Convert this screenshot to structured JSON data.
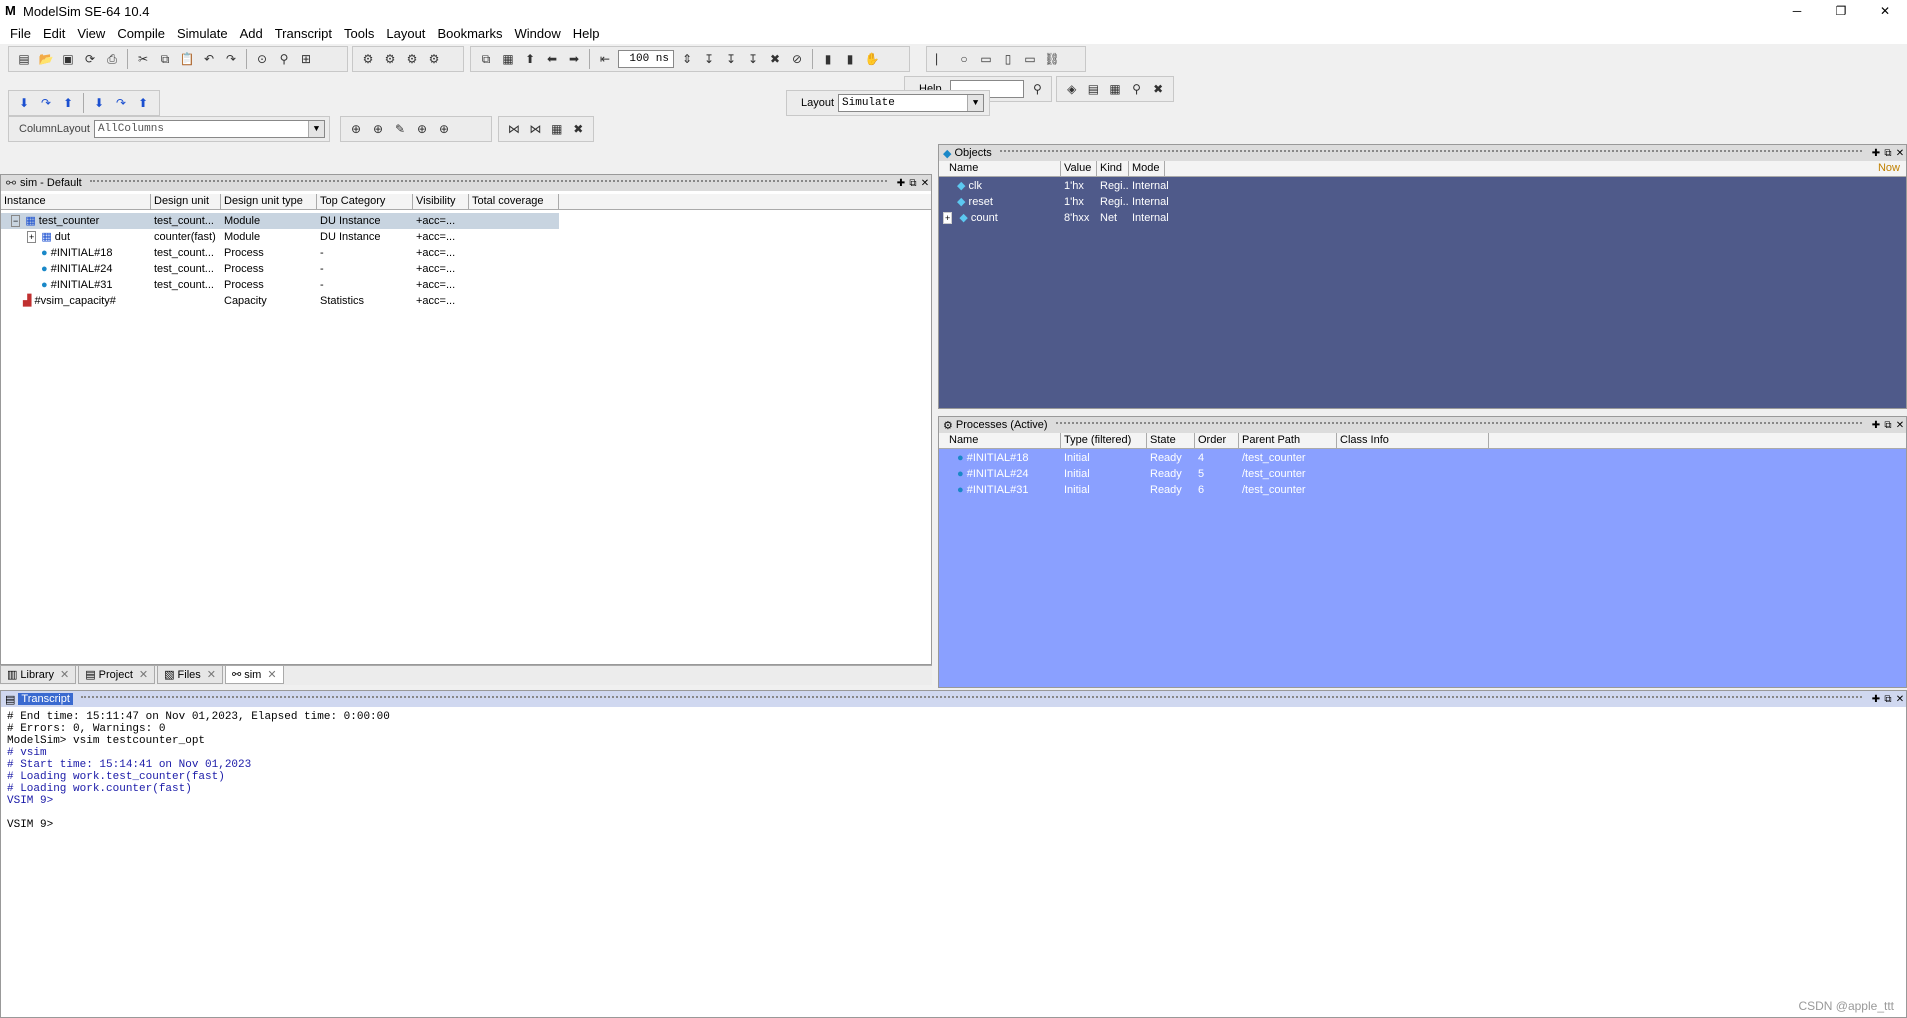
{
  "window": {
    "title": "ModelSim SE-64 10.4",
    "minimize": "─",
    "restore": "❐",
    "close": "✕"
  },
  "menu": [
    "File",
    "Edit",
    "View",
    "Compile",
    "Simulate",
    "Add",
    "Transcript",
    "Tools",
    "Layout",
    "Bookmarks",
    "Window",
    "Help"
  ],
  "toolbar": {
    "run_length": "100 ns",
    "help_label": "Help",
    "help_value": "",
    "layout_label": "Layout",
    "layout_value": "Simulate",
    "column_layout_label": "ColumnLayout",
    "column_layout_value": "AllColumns"
  },
  "sim_pane": {
    "title": "sim - Default",
    "columns": [
      "Instance",
      "Design unit",
      "Design unit type",
      "Top Category",
      "Visibility",
      "Total coverage"
    ],
    "rows": [
      {
        "instance": "test_counter",
        "unit": "test_count...",
        "type": "Module",
        "category": "DU Instance",
        "visibility": "+acc=...",
        "coverage": ""
      },
      {
        "instance": "dut",
        "unit": "counter(fast)",
        "type": "Module",
        "category": "DU Instance",
        "visibility": "+acc=...",
        "coverage": ""
      },
      {
        "instance": "#INITIAL#18",
        "unit": "test_count...",
        "type": "Process",
        "category": "-",
        "visibility": "+acc=...",
        "coverage": ""
      },
      {
        "instance": "#INITIAL#24",
        "unit": "test_count...",
        "type": "Process",
        "category": "-",
        "visibility": "+acc=...",
        "coverage": ""
      },
      {
        "instance": "#INITIAL#31",
        "unit": "test_count...",
        "type": "Process",
        "category": "-",
        "visibility": "+acc=...",
        "coverage": ""
      },
      {
        "instance": "#vsim_capacity#",
        "unit": "",
        "type": "Capacity",
        "category": "Statistics",
        "visibility": "+acc=...",
        "coverage": ""
      }
    ]
  },
  "objects_pane": {
    "title": "Objects",
    "columns": [
      "Name",
      "Value",
      "Kind",
      "Mode"
    ],
    "now_label": "Now",
    "rows": [
      {
        "name": "clk",
        "value": "1'hx",
        "kind": "Regi...",
        "mode": "Internal"
      },
      {
        "name": "reset",
        "value": "1'hx",
        "kind": "Regi...",
        "mode": "Internal"
      },
      {
        "name": "count",
        "value": "8'hxx",
        "kind": "Net",
        "mode": "Internal"
      }
    ]
  },
  "processes_pane": {
    "title": "Processes (Active)",
    "columns": [
      "Name",
      "Type (filtered)",
      "State",
      "Order",
      "Parent Path",
      "Class Info"
    ],
    "rows": [
      {
        "name": "#INITIAL#18",
        "type": "Initial",
        "state": "Ready",
        "order": "4",
        "path": "/test_counter",
        "cls": ""
      },
      {
        "name": "#INITIAL#24",
        "type": "Initial",
        "state": "Ready",
        "order": "5",
        "path": "/test_counter",
        "cls": ""
      },
      {
        "name": "#INITIAL#31",
        "type": "Initial",
        "state": "Ready",
        "order": "6",
        "path": "/test_counter",
        "cls": ""
      }
    ]
  },
  "bottom_tabs": [
    "Library",
    "Project",
    "Files",
    "sim"
  ],
  "transcript": {
    "title": "Transcript",
    "lines": [
      "# End time: 15:11:47 on Nov 01,2023, Elapsed time: 0:00:00",
      "# Errors: 0, Warnings: 0",
      "ModelSim> vsim testcounter_opt",
      "# vsim",
      "# Start time: 15:14:41 on Nov 01,2023",
      "# Loading work.test_counter(fast)",
      "# Loading work.counter(fast)",
      "VSIM 9>",
      "",
      "VSIM 9> "
    ]
  },
  "watermark": "CSDN @apple_ttt",
  "colors": {
    "objects_bg": "#4f5a8a",
    "processes_bg": "#8aa0ff",
    "selected_row": "#c8d4e0"
  }
}
